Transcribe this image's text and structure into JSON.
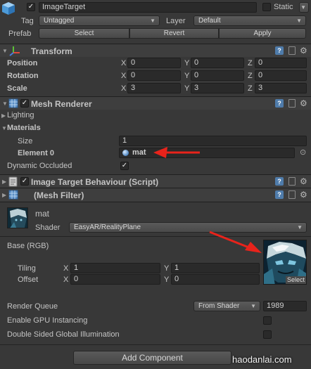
{
  "header": {
    "object_name": "ImageTarget",
    "static_label": "Static",
    "tag_label": "Tag",
    "tag_value": "Untagged",
    "layer_label": "Layer",
    "layer_value": "Default",
    "prefab_label": "Prefab",
    "prefab_buttons": [
      "Select",
      "Revert",
      "Apply"
    ]
  },
  "transform": {
    "title": "Transform",
    "rows": [
      {
        "label": "Position",
        "x": "0",
        "y": "0",
        "z": "0"
      },
      {
        "label": "Rotation",
        "x": "0",
        "y": "0",
        "z": "0"
      },
      {
        "label": "Scale",
        "x": "3",
        "y": "3",
        "z": "3"
      }
    ],
    "axis_labels": [
      "X",
      "Y",
      "Z"
    ]
  },
  "mesh_renderer": {
    "title": "Mesh Renderer",
    "lighting_label": "Lighting",
    "materials_label": "Materials",
    "size_label": "Size",
    "size_value": "1",
    "element_label": "Element 0",
    "element_value": "mat",
    "dynamic_occluded_label": "Dynamic Occluded"
  },
  "image_target_behaviour": {
    "title": "Image Target Behaviour (Script)"
  },
  "mesh_filter": {
    "title": "(Mesh Filter)"
  },
  "material": {
    "name": "mat",
    "shader_label": "Shader",
    "shader_value": "EasyAR/RealityPlane",
    "base_label": "Base (RGB)",
    "tiling_label": "Tiling",
    "tiling_x": "1",
    "tiling_y": "1",
    "offset_label": "Offset",
    "offset_x": "0",
    "offset_y": "0",
    "texture_select_label": "Select",
    "render_queue_label": "Render Queue",
    "render_queue_mode": "From Shader",
    "render_queue_value": "1989",
    "gpu_instancing_label": "Enable GPU Instancing",
    "double_sided_gi_label": "Double Sided Global Illumination"
  },
  "footer": {
    "add_component_label": "Add Component",
    "watermark": "haodanlai.com"
  },
  "colors": {
    "panel_bg": "#383838",
    "field_bg": "#2a2a2a",
    "annotation_arrow": "#e8231b",
    "help_icon": "#4f7cab"
  }
}
